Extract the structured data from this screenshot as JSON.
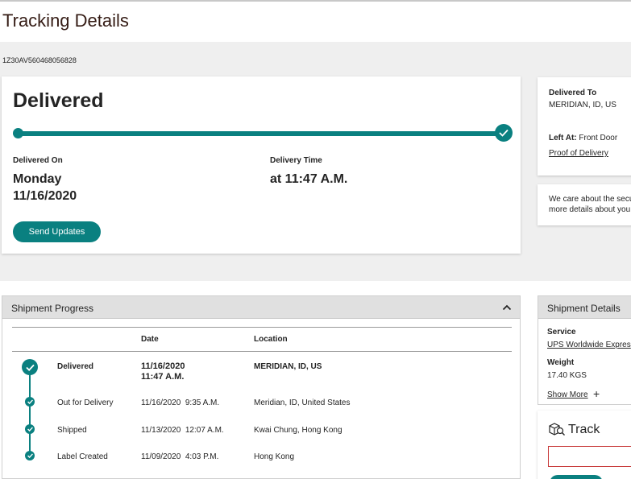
{
  "page": {
    "title": "Tracking Details",
    "tracking_number": "1Z30AV560468056828"
  },
  "summary": {
    "status": "Delivered",
    "progress_percent": 100,
    "delivered_on_label": "Delivered On",
    "delivered_on_day": "Monday",
    "delivered_on_date": "11/16/2020",
    "delivery_time_label": "Delivery Time",
    "delivery_time_value": "at 11:47 A.M.",
    "send_updates_label": "Send Updates"
  },
  "delivery_info": {
    "delivered_to_label": "Delivered To",
    "delivered_to_value": "MERIDIAN, ID, US",
    "left_at_label": "Left At:",
    "left_at_value": "Front Door",
    "proof_link": "Proof of Delivery",
    "security_line1": "We care about the secu",
    "security_line2": "more details about you"
  },
  "shipment_progress": {
    "title": "Shipment Progress",
    "columns": [
      "Date",
      "Location"
    ],
    "rows": [
      {
        "status": "Delivered",
        "date": "11/16/2020",
        "time": "11:47 A.M.",
        "location": "MERIDIAN, ID, US"
      },
      {
        "status": "Out for Delivery",
        "date": "11/16/2020",
        "time": "9:35 A.M.",
        "location": "Meridian, ID, United States"
      },
      {
        "status": "Shipped",
        "date": "11/13/2020",
        "time": "12:07 A.M.",
        "location": "Kwai Chung, Hong Kong"
      },
      {
        "status": "Label Created",
        "date": "11/09/2020",
        "time": "4:03 P.M.",
        "location": "Hong Kong"
      }
    ]
  },
  "shipment_details": {
    "title": "Shipment Details",
    "service_label": "Service",
    "service_value": "UPS Worldwide Expres",
    "weight_label": "Weight",
    "weight_value": "17.40 KGS",
    "show_more": "Show More",
    "show_more_icon": "plus-icon"
  },
  "track": {
    "title": "Track",
    "input_value": ""
  },
  "colors": {
    "accent": "#0a8080",
    "title": "#351c15",
    "band": "#efefef"
  }
}
